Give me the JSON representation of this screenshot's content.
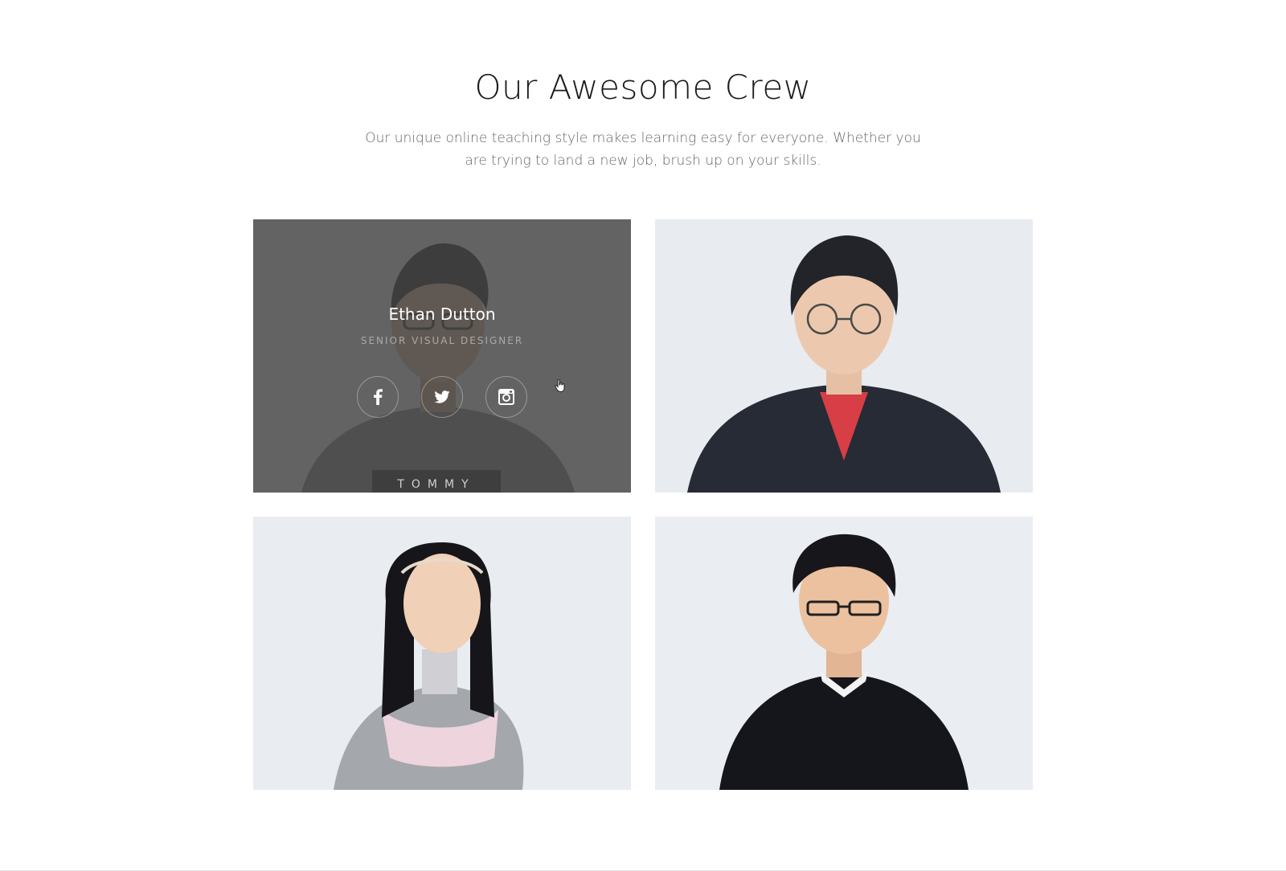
{
  "section": {
    "title": "Our Awesome Crew",
    "subtitle": "Our unique online teaching style makes learning easy for everyone. Whether you are trying to land a new job, brush up on your skills."
  },
  "team": [
    {
      "name": "Ethan Dutton",
      "role": "SENIOR VISUAL DESIGNER",
      "shirt_text": "TOMMY",
      "hovered": true,
      "socials": [
        {
          "icon": "facebook-icon",
          "glyph": "f"
        },
        {
          "icon": "twitter-icon",
          "glyph": "t"
        },
        {
          "icon": "instagram-icon",
          "glyph": "i"
        }
      ]
    },
    {
      "hovered": false
    },
    {
      "hovered": false
    },
    {
      "hovered": false
    }
  ],
  "colors": {
    "overlay": "#464646",
    "photo_background": "#e9edf3",
    "title": "#1c1c1c",
    "subtitle": "#666666"
  }
}
